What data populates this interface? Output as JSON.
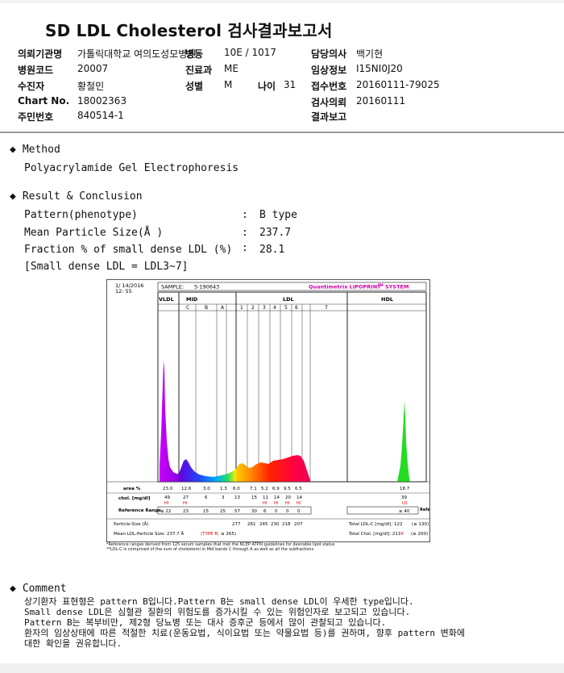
{
  "title": "SD LDL Cholesterol 검사결과보고서",
  "header": {
    "hospital_label": "의뢰기관명",
    "hospital": "가톨릭대학교 여의도성모병원",
    "ward_label": "병동",
    "ward": "10E / 1017",
    "doctor_label": "담당의사",
    "doctor": "백기현",
    "code_label": "병원코드",
    "code": "20007",
    "dept_label": "진료과",
    "dept": "ME",
    "clinical_label": "임상정보",
    "clinical": "I15NI0J20",
    "patient_label": "수진자",
    "patient": "황철민",
    "sex_label": "성별",
    "sex": "M",
    "age_label": "나이",
    "age": "31",
    "receipt_label": "접수번호",
    "receipt": "20160111-79025",
    "chart_label": "Chart No.",
    "chart": "18002363",
    "request_label": "검사의뢰",
    "request": "20160111",
    "id_label": "주민번호",
    "id": "840514-1",
    "result_label": "결과보고",
    "result": ""
  },
  "method": {
    "heading": "Method",
    "text": "Polyacrylamide Gel Electrophoresis"
  },
  "result_section": {
    "heading": "Result & Conclusion",
    "rows": [
      {
        "label": "Pattern(phenotype)",
        "value": "B type"
      },
      {
        "label": "Mean Particle Size(Å )",
        "value": "237.7"
      },
      {
        "label": "Fraction % of small dense LDL (%)",
        "value": "28.1"
      }
    ],
    "note": "[Small dense LDL = LDL3~7]"
  },
  "report": {
    "date": "1/ 14/2016",
    "time": "12: 55",
    "sample_label": "SAMPLE:",
    "sample": "5-190643",
    "brand": "Quantimetrix LIPOPRINT",
    "brand_tm": "TM",
    "brand_suffix": "SYSTEM",
    "bands": [
      "VLDL",
      "MID",
      "LDL",
      "HDL"
    ],
    "sub_bands": [
      "C",
      "B",
      "A",
      "1",
      "2",
      "3",
      "4",
      "5",
      "6",
      "7"
    ],
    "row_labels": [
      "area %",
      "chol. [mg/dl]",
      "Reference Range"
    ],
    "area": [
      "23.0",
      "12.6",
      "3.0",
      "1.3",
      "6.0",
      "7.1",
      "5.2",
      "6.9",
      "9.5",
      "6.5",
      "18.7"
    ],
    "chol": [
      "49",
      "27",
      "6",
      "3",
      "13",
      "15",
      "11",
      "14",
      "20",
      "14",
      "39"
    ],
    "chol_flags": [
      "HI",
      "HI",
      "",
      "",
      "",
      "",
      "HI",
      "HI",
      "HI",
      "HI",
      "LO"
    ],
    "ref": [
      "≤ 22",
      "23",
      "15",
      "25",
      "57",
      "30",
      "6",
      "0",
      "0",
      "0",
      "≥ 40"
    ],
    "particle_label": "Particle-Size (Å)",
    "particle": [
      "277",
      "261",
      "245",
      "230",
      "218",
      "207"
    ],
    "total_ldlc": "Total LDL-C [mg/dl]:  122",
    "total_ldlc_ref": "(≤ 130)",
    "mean_size": "Mean LDL-Particle Size:  237.7 Å",
    "mean_type": "(TYPE B;",
    "mean_ref": "≤ 265)",
    "total_chol": "Total Chol. [mg/dl]:  211",
    "total_chol_flag": "HI",
    "total_chol_ref": "(≤ 200)",
    "foot1": "*Reference ranges derived from 125 serum samples that met the NCEP ATPIII guidelines for desirable lipid status",
    "foot2": "**LDL-C is comprised of the sum of cholesterol in Mid bands C through A as well as all the subfractions"
  },
  "comment": {
    "heading": "Comment",
    "lines": [
      "상기환자 표현형은 pattern B입니다.Pattern B는 small dense LDL이 우세한 type입니다.",
      "Small dense LDL은 심혈관 질환의 위험도를 증가시킬 수 있는 위험인자로 보고되고 있습니다.",
      "Pattern B는 복부비만, 제2형 당뇨병 또는 대사 증후군 등에서 많이 관찰되고 있습니다.",
      "환자의 임상상태에 따른 적절한 치료(운동요법, 식이요법 또는 약물요법 등)를 권하며, 향후 pattern 변화에",
      "대한 확인을 권유합니다."
    ]
  }
}
